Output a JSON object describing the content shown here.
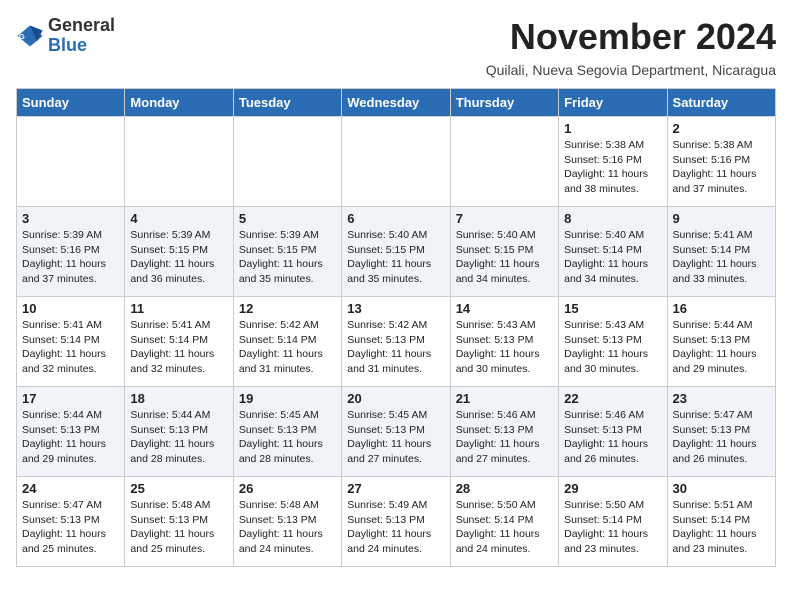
{
  "logo": {
    "general": "General",
    "blue": "Blue"
  },
  "title": "November 2024",
  "subtitle": "Quilali, Nueva Segovia Department, Nicaragua",
  "days_of_week": [
    "Sunday",
    "Monday",
    "Tuesday",
    "Wednesday",
    "Thursday",
    "Friday",
    "Saturday"
  ],
  "weeks": [
    [
      {
        "day": "",
        "info": ""
      },
      {
        "day": "",
        "info": ""
      },
      {
        "day": "",
        "info": ""
      },
      {
        "day": "",
        "info": ""
      },
      {
        "day": "",
        "info": ""
      },
      {
        "day": "1",
        "info": "Sunrise: 5:38 AM\nSunset: 5:16 PM\nDaylight: 11 hours and 38 minutes."
      },
      {
        "day": "2",
        "info": "Sunrise: 5:38 AM\nSunset: 5:16 PM\nDaylight: 11 hours and 37 minutes."
      }
    ],
    [
      {
        "day": "3",
        "info": "Sunrise: 5:39 AM\nSunset: 5:16 PM\nDaylight: 11 hours and 37 minutes."
      },
      {
        "day": "4",
        "info": "Sunrise: 5:39 AM\nSunset: 5:15 PM\nDaylight: 11 hours and 36 minutes."
      },
      {
        "day": "5",
        "info": "Sunrise: 5:39 AM\nSunset: 5:15 PM\nDaylight: 11 hours and 35 minutes."
      },
      {
        "day": "6",
        "info": "Sunrise: 5:40 AM\nSunset: 5:15 PM\nDaylight: 11 hours and 35 minutes."
      },
      {
        "day": "7",
        "info": "Sunrise: 5:40 AM\nSunset: 5:15 PM\nDaylight: 11 hours and 34 minutes."
      },
      {
        "day": "8",
        "info": "Sunrise: 5:40 AM\nSunset: 5:14 PM\nDaylight: 11 hours and 34 minutes."
      },
      {
        "day": "9",
        "info": "Sunrise: 5:41 AM\nSunset: 5:14 PM\nDaylight: 11 hours and 33 minutes."
      }
    ],
    [
      {
        "day": "10",
        "info": "Sunrise: 5:41 AM\nSunset: 5:14 PM\nDaylight: 11 hours and 32 minutes."
      },
      {
        "day": "11",
        "info": "Sunrise: 5:41 AM\nSunset: 5:14 PM\nDaylight: 11 hours and 32 minutes."
      },
      {
        "day": "12",
        "info": "Sunrise: 5:42 AM\nSunset: 5:14 PM\nDaylight: 11 hours and 31 minutes."
      },
      {
        "day": "13",
        "info": "Sunrise: 5:42 AM\nSunset: 5:13 PM\nDaylight: 11 hours and 31 minutes."
      },
      {
        "day": "14",
        "info": "Sunrise: 5:43 AM\nSunset: 5:13 PM\nDaylight: 11 hours and 30 minutes."
      },
      {
        "day": "15",
        "info": "Sunrise: 5:43 AM\nSunset: 5:13 PM\nDaylight: 11 hours and 30 minutes."
      },
      {
        "day": "16",
        "info": "Sunrise: 5:44 AM\nSunset: 5:13 PM\nDaylight: 11 hours and 29 minutes."
      }
    ],
    [
      {
        "day": "17",
        "info": "Sunrise: 5:44 AM\nSunset: 5:13 PM\nDaylight: 11 hours and 29 minutes."
      },
      {
        "day": "18",
        "info": "Sunrise: 5:44 AM\nSunset: 5:13 PM\nDaylight: 11 hours and 28 minutes."
      },
      {
        "day": "19",
        "info": "Sunrise: 5:45 AM\nSunset: 5:13 PM\nDaylight: 11 hours and 28 minutes."
      },
      {
        "day": "20",
        "info": "Sunrise: 5:45 AM\nSunset: 5:13 PM\nDaylight: 11 hours and 27 minutes."
      },
      {
        "day": "21",
        "info": "Sunrise: 5:46 AM\nSunset: 5:13 PM\nDaylight: 11 hours and 27 minutes."
      },
      {
        "day": "22",
        "info": "Sunrise: 5:46 AM\nSunset: 5:13 PM\nDaylight: 11 hours and 26 minutes."
      },
      {
        "day": "23",
        "info": "Sunrise: 5:47 AM\nSunset: 5:13 PM\nDaylight: 11 hours and 26 minutes."
      }
    ],
    [
      {
        "day": "24",
        "info": "Sunrise: 5:47 AM\nSunset: 5:13 PM\nDaylight: 11 hours and 25 minutes."
      },
      {
        "day": "25",
        "info": "Sunrise: 5:48 AM\nSunset: 5:13 PM\nDaylight: 11 hours and 25 minutes."
      },
      {
        "day": "26",
        "info": "Sunrise: 5:48 AM\nSunset: 5:13 PM\nDaylight: 11 hours and 24 minutes."
      },
      {
        "day": "27",
        "info": "Sunrise: 5:49 AM\nSunset: 5:13 PM\nDaylight: 11 hours and 24 minutes."
      },
      {
        "day": "28",
        "info": "Sunrise: 5:50 AM\nSunset: 5:14 PM\nDaylight: 11 hours and 24 minutes."
      },
      {
        "day": "29",
        "info": "Sunrise: 5:50 AM\nSunset: 5:14 PM\nDaylight: 11 hours and 23 minutes."
      },
      {
        "day": "30",
        "info": "Sunrise: 5:51 AM\nSunset: 5:14 PM\nDaylight: 11 hours and 23 minutes."
      }
    ]
  ]
}
